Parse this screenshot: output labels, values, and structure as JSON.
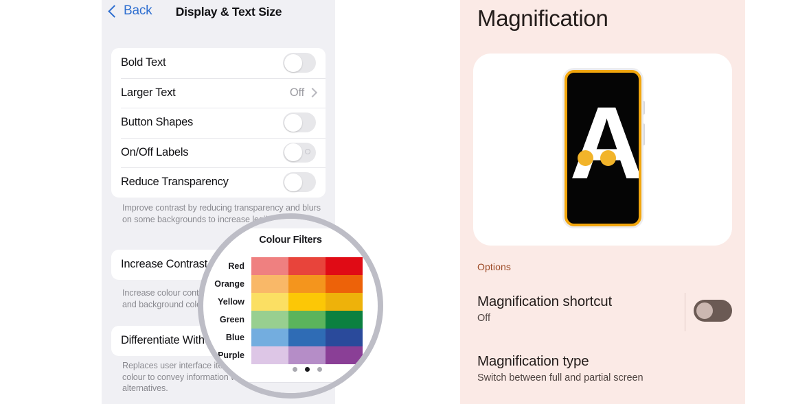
{
  "ios": {
    "nav": {
      "back_label": "Back",
      "title": "Display & Text Size"
    },
    "groups": [
      {
        "rows": [
          {
            "label": "Bold Text",
            "control": "switch",
            "state": "off"
          },
          {
            "label": "Larger Text",
            "control": "disclosure",
            "value": "Off"
          },
          {
            "label": "Button Shapes",
            "control": "switch",
            "state": "off"
          },
          {
            "label": "On/Off Labels",
            "control": "switch-offmark",
            "state": "off"
          },
          {
            "label": "Reduce Transparency",
            "control": "switch",
            "state": "off"
          }
        ],
        "footnote": "Improve contrast by reducing transparency and blurs on some backgrounds to increase legibility."
      },
      {
        "rows": [
          {
            "label": "Increase Contrast",
            "control": "switch",
            "state": "off"
          }
        ],
        "footnote": "Increase colour contrast between app foreground and background colours."
      },
      {
        "rows": [
          {
            "label": "Differentiate Without Colour",
            "control": "switch",
            "state": "off"
          }
        ],
        "footnote": "Replaces user interface items that rely solely on colour to convey information with shaped alternatives."
      }
    ],
    "row_labels": {
      "bold_text": "Bold Text",
      "larger_text": "Larger Text",
      "larger_text_value": "Off",
      "button_shapes": "Button Shapes",
      "onoff_labels": "On/Off Labels",
      "reduce_transparency": "Reduce Transparency",
      "increase_contrast": "Increase Contrast",
      "differentiate_without_colour": "Differentiate Without Colour"
    },
    "footnotes": {
      "one": "Improve contrast by reducing transparency and blurs on some backgrounds to increase legibility.",
      "two": "Increase colour contrast between app foreground and background colours.",
      "three": "Replaces user interface items that rely solely on colour to convey information with shaped alternatives."
    }
  },
  "lens": {
    "header": "Colour Filters",
    "swatches": {
      "rows": [
        {
          "label": "Red",
          "colors": [
            "#ef8080",
            "#e8443b",
            "#e00b15"
          ]
        },
        {
          "label": "Orange",
          "colors": [
            "#f9b868",
            "#f4951d",
            "#ed6209"
          ]
        },
        {
          "label": "Yellow",
          "colors": [
            "#fbdf63",
            "#fcc706",
            "#eeb20a"
          ]
        },
        {
          "label": "Green",
          "colors": [
            "#98cf90",
            "#5bb45c",
            "#0b8040"
          ]
        },
        {
          "label": "Blue",
          "colors": [
            "#73addf",
            "#2f6cb5",
            "#2a4a9b"
          ]
        },
        {
          "label": "Purple",
          "colors": [
            "#ddc6e6",
            "#b58dc7",
            "#8a3f96"
          ]
        }
      ]
    },
    "page_dots": {
      "count": 3,
      "active_index": 1
    }
  },
  "android": {
    "title": "Magnification",
    "illustration": {
      "letter": "A",
      "phone_frame_color": "#f2a60d",
      "touch_dot_color": "#f2b42a",
      "screen_color": "#050505"
    },
    "section_label": "Options",
    "items": [
      {
        "title": "Magnification shortcut",
        "subtitle": "Off",
        "control": "switch",
        "state": "off"
      },
      {
        "title": "Magnification type",
        "subtitle": "Switch between full and partial screen",
        "control": "none"
      }
    ],
    "colors": {
      "background": "#fbeae6",
      "section_label": "#9c4a26",
      "switch_track": "#6b5a54",
      "switch_thumb": "#cbb7b1"
    }
  }
}
